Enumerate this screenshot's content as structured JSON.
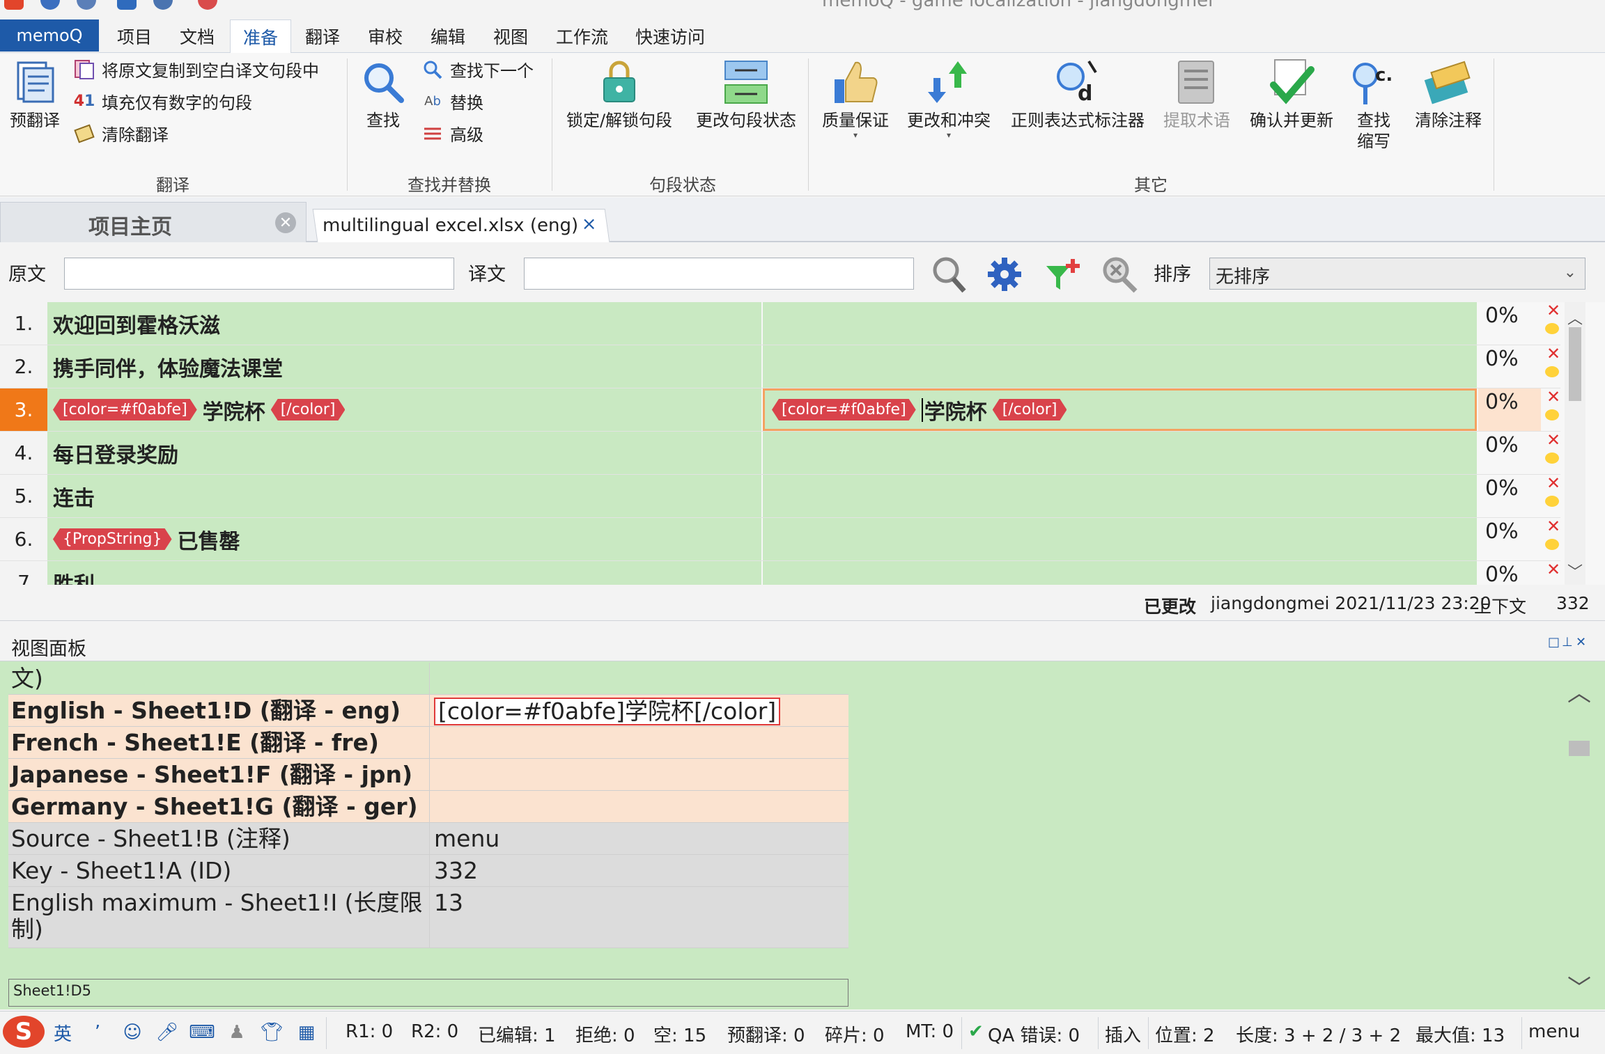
{
  "window": {
    "title": "memoQ - game localization - jiangdongmei"
  },
  "menu": {
    "app_label": "memoQ",
    "tabs": [
      "项目",
      "文档",
      "准备",
      "翻译",
      "审校",
      "编辑",
      "视图",
      "工作流",
      "快速访问"
    ],
    "active_tab": "准备"
  },
  "ribbon": {
    "translate": {
      "label": "翻译",
      "pretranslate": "预翻译",
      "copy_source": "将原文复制到空白译文句段中",
      "fill_numbers": "填充仅有数字的句段",
      "clear_translation": "清除翻译"
    },
    "find": {
      "label": "查找并替换",
      "find": "查找",
      "find_next": "查找下一个",
      "replace": "替换",
      "advanced": "高级"
    },
    "segment_status": {
      "label": "句段状态",
      "lock_unlock": "锁定/解锁句段",
      "change_status": "更改句段状态"
    },
    "other": {
      "label": "其它",
      "qa": "质量保证",
      "changes_conflicts": "更改和冲突",
      "regex_tagger": "正则表达式标注器",
      "extract_terms": "提取术语",
      "confirm_update": "确认并更新",
      "find_abbrev_1": "查找",
      "find_abbrev_2": "缩写",
      "clear_comments": "清除注释"
    }
  },
  "doc_tabs": {
    "home": "项目主页",
    "file": "multilingual excel.xlsx (eng)",
    "close": "×"
  },
  "filter": {
    "source_label": "原文",
    "target_label": "译文",
    "sort_label": "排序",
    "sort_value": "无排序"
  },
  "grid": {
    "rows": [
      {
        "num": "1.",
        "source": "欢迎回到霍格沃滋",
        "pct": "0%"
      },
      {
        "num": "2.",
        "source": "携手同伴，体验魔法课堂",
        "pct": "0%"
      },
      {
        "num": "3.",
        "tag_open": "[color=#f0abfe]",
        "source": "学院杯",
        "tag_close": "[/color]",
        "target_tag_open": "[color=#f0abfe]",
        "target": "学院杯",
        "target_tag_close": "[/color]",
        "pct": "0%"
      },
      {
        "num": "4.",
        "source": "每日登录奖励",
        "pct": "0%"
      },
      {
        "num": "5.",
        "source": "连击",
        "pct": "0%"
      },
      {
        "num": "6.",
        "tag_open": "{PropString}",
        "source": "已售罄",
        "pct": "0%"
      },
      {
        "num": "7",
        "source": "胜利",
        "pct": "0%"
      }
    ]
  },
  "info_line": {
    "status": "已更改",
    "user_time": "jiangdongmei 2021/11/23 23:20",
    "context": "上下文",
    "id": "332"
  },
  "view_pane": {
    "title": "视图面板",
    "top_fragment": "文)",
    "rows": [
      {
        "key": "English - Sheet1!D (翻译 - eng)",
        "value": "[color=#f0abfe]学院杯[/color]"
      },
      {
        "key": "French - Sheet1!E (翻译 - fre)",
        "value": ""
      },
      {
        "key": "Japanese - Sheet1!F (翻译 - jpn)",
        "value": ""
      },
      {
        "key": "Germany - Sheet1!G (翻译 - ger)",
        "value": ""
      },
      {
        "key": "Source - Sheet1!B (注释)",
        "value": "menu"
      },
      {
        "key": "Key - Sheet1!A (ID)",
        "value": "332"
      },
      {
        "key": "English maximum - Sheet1!I (长度限制)",
        "value": "13"
      }
    ],
    "sheet_ref": "Sheet1!D5"
  },
  "status_bar": {
    "ime_lang": "英",
    "r1": "R1: 0",
    "r2": "R2: 0",
    "edited": "已编辑: 1",
    "rejected": "拒绝: 0",
    "empty": "空: 15",
    "pretranslated": "预翻译: 0",
    "fragments": "碎片: 0",
    "mt": "MT: 0",
    "qa_errors": "QA 错误:  0",
    "insert": "插入",
    "position": "位置:  2",
    "length": "长度:  3 + 2 / 3 + 2",
    "max": "最大值:  13",
    "context": "menu"
  },
  "colors": {
    "accent": "#1e5aa8",
    "active_row": "#f07818",
    "segment_bg": "#c9e9c2",
    "tag": "#d9434b"
  }
}
